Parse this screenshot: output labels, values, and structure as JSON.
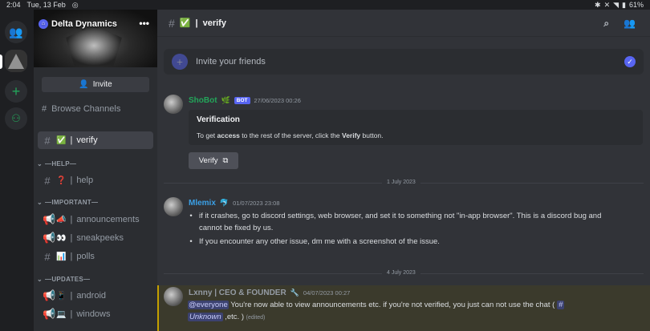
{
  "status_bar": {
    "time": "2:04",
    "date": "Tue, 13 Feb",
    "battery": "61%"
  },
  "server": {
    "name": "Delta Dynamics",
    "more": "•••",
    "invite_label": "Invite",
    "browse_label": "Browse Channels"
  },
  "channels": {
    "verify": {
      "emoji": "✅",
      "name": "verify"
    },
    "categories": [
      {
        "label": "—HELP—"
      },
      {
        "label": "—IMPORTANT—"
      },
      {
        "label": "—UPDATES—"
      }
    ],
    "help": {
      "emoji": "❓",
      "name": "help"
    },
    "announcements": {
      "emoji": "📣",
      "name": "announcements"
    },
    "sneakpeeks": {
      "emoji": "👀",
      "name": "sneakpeeks"
    },
    "polls": {
      "emoji": "📊",
      "name": "polls"
    },
    "android": {
      "emoji": "📱",
      "name": "android"
    },
    "windows": {
      "emoji": "💻",
      "name": "windows"
    }
  },
  "header": {
    "channel_emoji": "✅",
    "channel_name": "verify"
  },
  "invite_banner": {
    "text": "Invite your friends"
  },
  "messages": [
    {
      "author": "ShoBot",
      "author_badge": "🌿",
      "bot_tag": "BOT",
      "timestamp": "27/06/2023 00:26",
      "embed_title": "Verification",
      "embed_pre": "To get ",
      "embed_bold1": "access",
      "embed_mid": " to the rest of the server, click the ",
      "embed_bold2": "Verify",
      "embed_post": " button.",
      "button_label": "Verify"
    },
    {
      "author": "Mlemix",
      "author_badge": "🐬",
      "timestamp": "01/07/2023 23:08",
      "bullet1": "if it crashes, go to discord settings, web browser, and set it to something not \"in-app browser\". This is a discord bug and",
      "bullet1b": "cannot be fixed by us.",
      "bullet2": "If you encounter any other issue, dm me with a screenshot of the issue."
    },
    {
      "author": "Lxnny | CEO & FOUNDER",
      "author_badge": "🔧",
      "timestamp": "04/07/2023 00:27",
      "mention": "@everyone",
      "text": " You're now able to view announcements etc. if you're not verified, you just can not use the chat ( ",
      "channel_mention_hash": "#",
      "channel_mention": "Unknown",
      "text_end": " ,etc. )",
      "edited": "(edited)"
    }
  ],
  "dividers": {
    "first": "1 July 2023",
    "second": "4 July 2023"
  },
  "colors": {
    "accent": "#5865f2",
    "bot_author": "#23a55a",
    "mlemix_author": "#3ba0e6",
    "lxnny_author": "#949ba4",
    "highlight": "#3b3a2c"
  }
}
